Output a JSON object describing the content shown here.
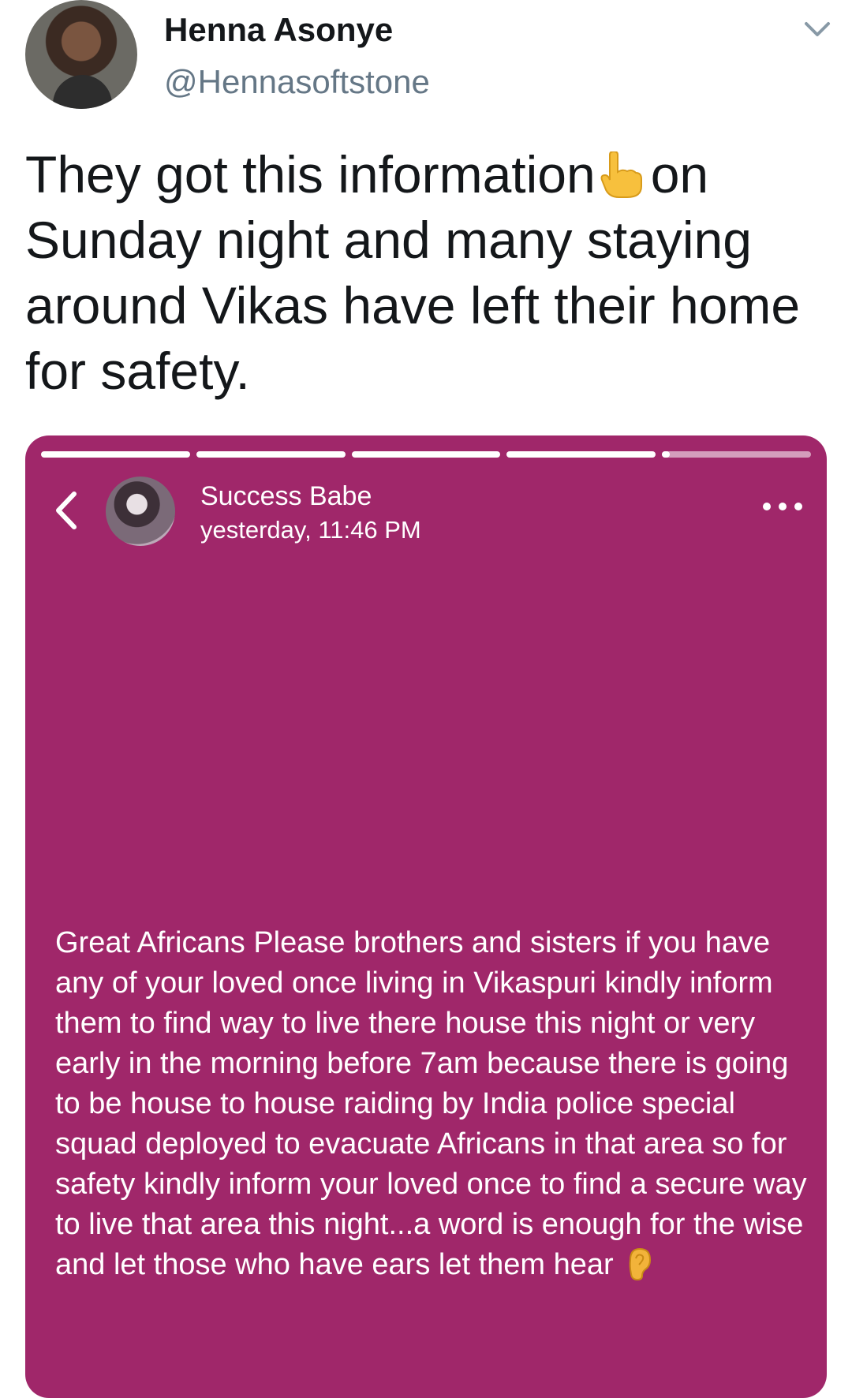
{
  "tweet": {
    "author_name": "Henna Asonye",
    "author_handle": "@Hennasoftstone",
    "text_part1": "They got this information",
    "text_part2": "on Sunday night and many staying around Vikas have left their home for safety."
  },
  "story": {
    "progress_segments": [
      1,
      1,
      1,
      1,
      0.05
    ],
    "user_name": "Success Babe",
    "timestamp": "yesterday, 11:46 PM",
    "text": "Great Africans Please brothers and sisters if you have any of your loved once living in Vikaspuri kindly inform them to find way to live there house this night or very early in the morning before 7am because there is going to be house to house raiding by India police special squad deployed to evacuate Africans in that area so for safety kindly inform your loved once to find a secure way to live that area this night...a word is enough for the wise and let those who have ears let them hear",
    "background_color": "#a0276a"
  },
  "icons": {
    "chevron": "chevron-down-icon",
    "pointing": "pointing-up-icon",
    "back": "back-arrow-icon",
    "more": "more-icon",
    "ear": "ear-icon"
  }
}
